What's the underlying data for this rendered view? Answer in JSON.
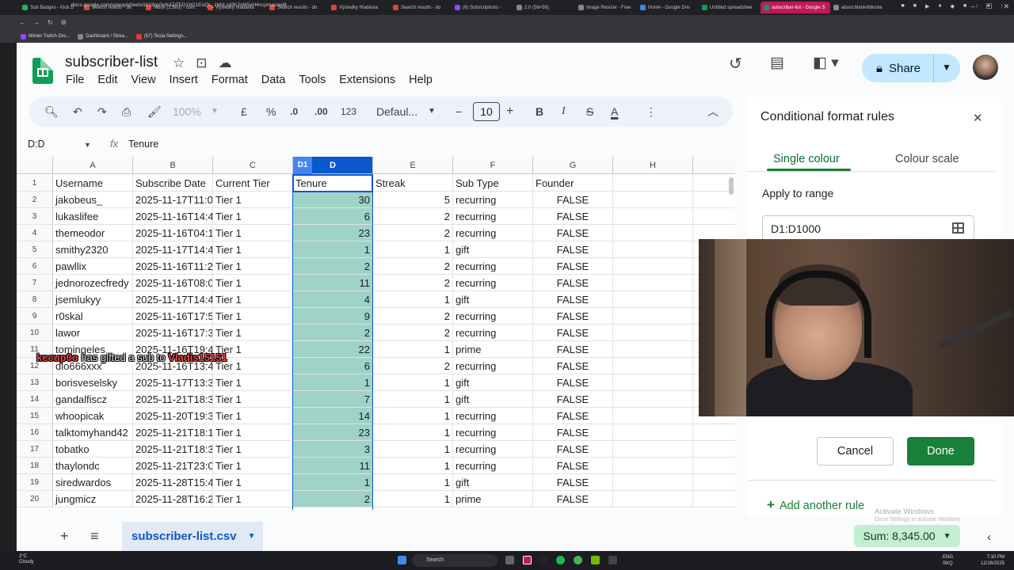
{
  "browser": {
    "tabs": [
      {
        "label": "Sub Badges - Kick D",
        "color": "#1db954"
      },
      {
        "label": "Search results - do",
        "color": "#db4437"
      },
      {
        "label": "Inbox (1,983) - cont",
        "color": "#db4437"
      },
      {
        "label": "Výsledky hľadania",
        "color": "#db4437"
      },
      {
        "label": "Search results - do",
        "color": "#db4437"
      },
      {
        "label": "Výsledky hľadania",
        "color": "#db4437"
      },
      {
        "label": "Search results - do",
        "color": "#db4437"
      },
      {
        "label": "(6) Subscriptions -",
        "color": "#9146ff"
      },
      {
        "label": "2.0 (56×56)",
        "color": "#888888"
      },
      {
        "label": "Image Resizer - Free",
        "color": "#888888"
      },
      {
        "label": "Home - Google Driv",
        "color": "#4285f4"
      },
      {
        "label": "Untitled spreadshee",
        "color": "#0f9d58"
      },
      {
        "label": "subscriber-list - Google S",
        "color": "#0f9d58",
        "active": true
      },
      {
        "label": "about:blank#blocke",
        "color": "#888888"
      }
    ],
    "url": "docs.google.com/spreadsheets/d/19qs0eKdZrfTiG1H21EoQL_zbNLxXfK7sM5xH4xcpmao/edit",
    "bookmarks": [
      "Winter Twitch Dro...",
      "Dashboard / Strea...",
      "(57) Tesla Settings..."
    ]
  },
  "doc": {
    "title": "subscriber-list",
    "menu": [
      "File",
      "Edit",
      "View",
      "Insert",
      "Format",
      "Data",
      "Tools",
      "Extensions",
      "Help"
    ],
    "share_label": "Share"
  },
  "toolbar": {
    "zoom": "100%",
    "currency": "£",
    "percent": "%",
    "dec_less": ".0",
    "dec_more": ".00",
    "number_format": "123",
    "font": "Defaul...",
    "font_size": "10",
    "bold": "B",
    "italic": "I",
    "strike": "S",
    "text_color": "A"
  },
  "formula_bar": {
    "name_box": "D:D",
    "fx": "fx",
    "value": "Tenure"
  },
  "grid": {
    "columns": [
      "A",
      "B",
      "C",
      "D",
      "E",
      "F",
      "G",
      "H"
    ],
    "selected_badge": "D1",
    "header_row": [
      "Username",
      "Subscribe Date",
      "Current Tier",
      "Tenure",
      "Streak",
      "Sub Type",
      "Founder",
      ""
    ],
    "rows": [
      {
        "n": "2",
        "user": "jakobeus_",
        "date": "2025-11-17T11:0",
        "tier": "Tier 1",
        "tenure": "30",
        "streak": "5",
        "type": "recurring",
        "founder": "FALSE"
      },
      {
        "n": "3",
        "user": "lukaslifee",
        "date": "2025-11-16T14:4",
        "tier": "Tier 1",
        "tenure": "6",
        "streak": "2",
        "type": "recurring",
        "founder": "FALSE"
      },
      {
        "n": "4",
        "user": "themeodor",
        "date": "2025-11-16T04:1",
        "tier": "Tier 1",
        "tenure": "23",
        "streak": "2",
        "type": "recurring",
        "founder": "FALSE"
      },
      {
        "n": "5",
        "user": "smithy2320",
        "date": "2025-11-17T14:4",
        "tier": "Tier 1",
        "tenure": "1",
        "streak": "1",
        "type": "gift",
        "founder": "FALSE"
      },
      {
        "n": "6",
        "user": "pawllix",
        "date": "2025-11-16T11:2",
        "tier": "Tier 1",
        "tenure": "2",
        "streak": "2",
        "type": "recurring",
        "founder": "FALSE"
      },
      {
        "n": "7",
        "user": "jednorozecfredy",
        "date": "2025-11-16T08:0",
        "tier": "Tier 1",
        "tenure": "11",
        "streak": "2",
        "type": "recurring",
        "founder": "FALSE"
      },
      {
        "n": "8",
        "user": "jsemlukyy",
        "date": "2025-11-17T14:4",
        "tier": "Tier 1",
        "tenure": "4",
        "streak": "1",
        "type": "gift",
        "founder": "FALSE"
      },
      {
        "n": "9",
        "user": "r0skal",
        "date": "2025-11-16T17:5",
        "tier": "Tier 1",
        "tenure": "9",
        "streak": "2",
        "type": "recurring",
        "founder": "FALSE"
      },
      {
        "n": "10",
        "user": "lawor",
        "date": "2025-11-16T17:3",
        "tier": "Tier 1",
        "tenure": "2",
        "streak": "2",
        "type": "recurring",
        "founder": "FALSE"
      },
      {
        "n": "11",
        "user": "tomingeles",
        "date": "2025-11-16T19:4",
        "tier": "Tier 1",
        "tenure": "22",
        "streak": "1",
        "type": "prime",
        "founder": "FALSE"
      },
      {
        "n": "12",
        "user": "dlo666xxx",
        "date": "2025-11-16T13:4",
        "tier": "Tier 1",
        "tenure": "6",
        "streak": "2",
        "type": "recurring",
        "founder": "FALSE"
      },
      {
        "n": "13",
        "user": "borisveselsky",
        "date": "2025-11-17T13:3",
        "tier": "Tier 1",
        "tenure": "1",
        "streak": "1",
        "type": "gift",
        "founder": "FALSE"
      },
      {
        "n": "14",
        "user": "gandalfiscz",
        "date": "2025-11-21T18:3",
        "tier": "Tier 1",
        "tenure": "7",
        "streak": "1",
        "type": "gift",
        "founder": "FALSE"
      },
      {
        "n": "15",
        "user": "whoopicak",
        "date": "2025-11-20T19:3",
        "tier": "Tier 1",
        "tenure": "14",
        "streak": "1",
        "type": "recurring",
        "founder": "FALSE"
      },
      {
        "n": "16",
        "user": "talktomyhand42",
        "date": "2025-11-21T18:1",
        "tier": "Tier 1",
        "tenure": "23",
        "streak": "1",
        "type": "recurring",
        "founder": "FALSE"
      },
      {
        "n": "17",
        "user": "tobatko",
        "date": "2025-11-21T18:3",
        "tier": "Tier 1",
        "tenure": "3",
        "streak": "1",
        "type": "recurring",
        "founder": "FALSE"
      },
      {
        "n": "18",
        "user": "thaylondc",
        "date": "2025-11-21T23:0",
        "tier": "Tier 1",
        "tenure": "11",
        "streak": "1",
        "type": "recurring",
        "founder": "FALSE"
      },
      {
        "n": "19",
        "user": "siredwardos",
        "date": "2025-11-28T15:4",
        "tier": "Tier 1",
        "tenure": "1",
        "streak": "1",
        "type": "gift",
        "founder": "FALSE"
      },
      {
        "n": "20",
        "user": "jungmicz",
        "date": "2025-11-28T16:2",
        "tier": "Tier 1",
        "tenure": "2",
        "streak": "1",
        "type": "prime",
        "founder": "FALSE"
      }
    ],
    "highlight_color": "#9fd3c6",
    "selection_color": "#0b57d0"
  },
  "stream_overlay": {
    "gifter": "kecup0o",
    "middle": "has gifted a sub to",
    "recipient": "Vladis15151"
  },
  "sheet_bar": {
    "add": "+",
    "list": "≡",
    "active_sheet": "subscriber-list.csv",
    "sum": "Sum: 8,345.00"
  },
  "panel": {
    "title": "Conditional format rules",
    "tab_single": "Single colour",
    "tab_scale": "Colour scale",
    "apply_label": "Apply to range",
    "range_value": "D1:D1000",
    "cancel": "Cancel",
    "done": "Done",
    "add_rule": "Add another rule",
    "accent": "#188038"
  },
  "watermark": {
    "line1": "Activate Windows",
    "line2": "Go to Settings to activate Windows."
  },
  "taskbar": {
    "weather_temp": "2°C",
    "weather_desc": "Cloudy",
    "search": "Search",
    "lang1": "ENG",
    "lang2": "SKQ",
    "time": "7:10 PM",
    "date": "12/16/2025"
  }
}
